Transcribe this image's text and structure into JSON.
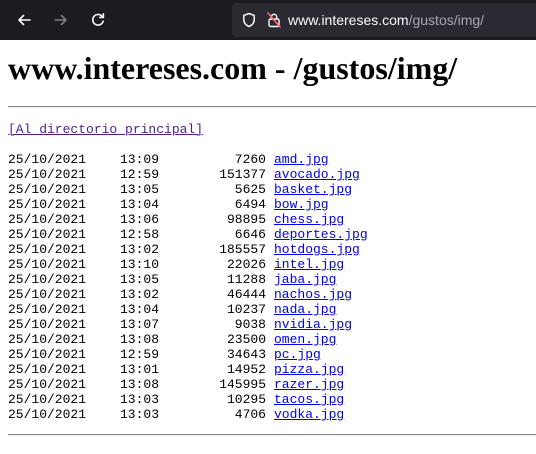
{
  "browser": {
    "url_host": "www.intereses.com",
    "url_path": "/gustos/img/"
  },
  "page": {
    "title": "www.intereses.com - /gustos/img/",
    "parent_link": "[Al directorio principal]"
  },
  "files": [
    {
      "date": "25/10/2021",
      "time": "13:09",
      "size": "7260",
      "name": "amd.jpg"
    },
    {
      "date": "25/10/2021",
      "time": "12:59",
      "size": "151377",
      "name": "avocado.jpg"
    },
    {
      "date": "25/10/2021",
      "time": "13:05",
      "size": "5625",
      "name": "basket.jpg"
    },
    {
      "date": "25/10/2021",
      "time": "13:04",
      "size": "6494",
      "name": "bow.jpg"
    },
    {
      "date": "25/10/2021",
      "time": "13:06",
      "size": "98895",
      "name": "chess.jpg"
    },
    {
      "date": "25/10/2021",
      "time": "12:58",
      "size": "6646",
      "name": "deportes.jpg"
    },
    {
      "date": "25/10/2021",
      "time": "13:02",
      "size": "185557",
      "name": "hotdogs.jpg"
    },
    {
      "date": "25/10/2021",
      "time": "13:10",
      "size": "22026",
      "name": "intel.jpg"
    },
    {
      "date": "25/10/2021",
      "time": "13:05",
      "size": "11288",
      "name": "jaba.jpg"
    },
    {
      "date": "25/10/2021",
      "time": "13:02",
      "size": "46444",
      "name": "nachos.jpg"
    },
    {
      "date": "25/10/2021",
      "time": "13:04",
      "size": "10237",
      "name": "nada.jpg"
    },
    {
      "date": "25/10/2021",
      "time": "13:07",
      "size": "9038",
      "name": "nvidia.jpg"
    },
    {
      "date": "25/10/2021",
      "time": "13:08",
      "size": "23500",
      "name": "omen.jpg"
    },
    {
      "date": "25/10/2021",
      "time": "12:59",
      "size": "34643",
      "name": "pc.jpg"
    },
    {
      "date": "25/10/2021",
      "time": "13:01",
      "size": "14952",
      "name": "pizza.jpg"
    },
    {
      "date": "25/10/2021",
      "time": "13:08",
      "size": "145995",
      "name": "razer.jpg"
    },
    {
      "date": "25/10/2021",
      "time": "13:03",
      "size": "10295",
      "name": "tacos.jpg"
    },
    {
      "date": "25/10/2021",
      "time": "13:03",
      "size": "4706",
      "name": "vodka.jpg"
    }
  ]
}
